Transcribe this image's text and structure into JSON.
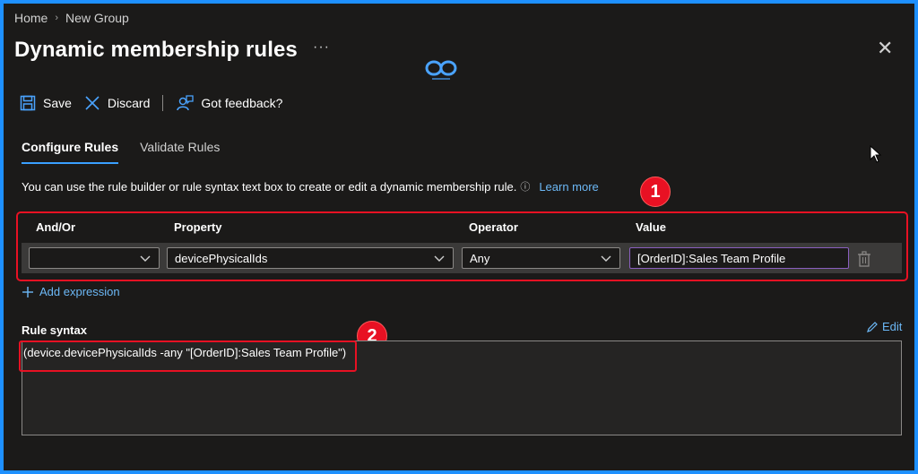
{
  "breadcrumb": {
    "home": "Home",
    "current": "New Group",
    "separator": "›"
  },
  "header": {
    "title": "Dynamic membership rules",
    "more": "···",
    "close": "✕"
  },
  "toolbar": {
    "save_label": "Save",
    "discard_label": "Discard",
    "feedback_label": "Got feedback?"
  },
  "tabs": [
    {
      "label": "Configure Rules",
      "active": true
    },
    {
      "label": "Validate Rules",
      "active": false
    }
  ],
  "info": {
    "text": "You can use the rule builder or rule syntax text box to create or edit a dynamic membership rule.",
    "icon": "ⓘ",
    "link": "Learn more"
  },
  "annotations": {
    "badge1": "1",
    "badge2": "2"
  },
  "rules": {
    "headers": {
      "and_or": "And/Or",
      "property": "Property",
      "operator": "Operator",
      "value": "Value"
    },
    "row": {
      "and_or": "",
      "property": "devicePhysicalIds",
      "operator": "Any",
      "value": "[OrderID]:Sales Team Profile"
    },
    "add_expression": "Add expression"
  },
  "syntax": {
    "label": "Rule syntax",
    "edit_label": "Edit",
    "value": "(device.devicePhysicalIds -any \"[OrderID]:Sales Team Profile\")"
  },
  "colors": {
    "accent": "#3aa0ff",
    "link": "#6cb8f6",
    "highlight": "#e81123",
    "background": "#1b1a19",
    "frame": "#1e90ff"
  }
}
